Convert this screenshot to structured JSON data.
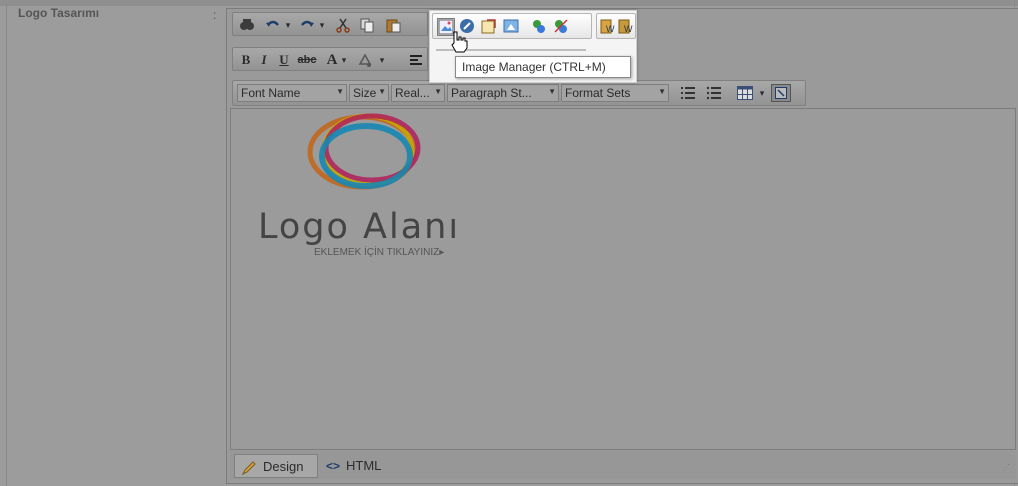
{
  "field": {
    "label": "Logo Tasarımı",
    "colon": ":"
  },
  "toolbar": {
    "row1": [
      "find-icon",
      "undo-icon",
      "redo-icon",
      "cut-icon",
      "copy-icon",
      "paste-icon"
    ],
    "highlighted": [
      "image-manager-icon",
      "link-icon",
      "template-icon",
      "media-icon",
      "hyperlink-icon",
      "remove-link-icon",
      "paste-word-icon",
      "paste-plain-icon"
    ],
    "row2": {
      "bold": "B",
      "italic": "I",
      "underline": "U",
      "strike": "abc",
      "font_color": "A"
    },
    "dropdowns": {
      "font_name": "Font Name",
      "size": "Size",
      "real": "Real...",
      "paragraph": "Paragraph St...",
      "format_sets": "Format Sets"
    }
  },
  "tooltip": {
    "text": "Image Manager (CTRL+M)"
  },
  "content": {
    "logo_text": "Logo Alanı",
    "logo_subtext": "EKLEMEK İÇİN TIKLAYINIZ▸"
  },
  "modes": {
    "design": "Design",
    "html": "HTML"
  },
  "colors": {
    "ring_blue": "#1aa3d8",
    "ring_magenta": "#d6246e",
    "ring_yellow": "#f2d000",
    "ring_orange": "#e87722"
  }
}
